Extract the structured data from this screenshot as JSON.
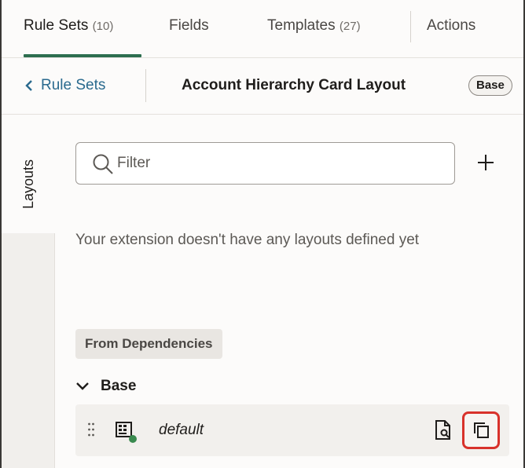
{
  "tabs": [
    {
      "label": "Rule Sets",
      "count": "(10)"
    },
    {
      "label": "Fields",
      "count": ""
    },
    {
      "label": "Templates",
      "count": "(27)"
    },
    {
      "label": "Actions",
      "count": ""
    }
  ],
  "breadcrumb": {
    "back_label": "Rule Sets",
    "title": "Account Hierarchy Card Layout",
    "badge": "Base"
  },
  "side_tab": {
    "label": "Layouts"
  },
  "filter": {
    "placeholder": "Filter"
  },
  "empty_message": "Your extension doesn't have any layouts defined yet",
  "dependencies": {
    "badge": "From Dependencies",
    "group_label": "Base",
    "items": [
      {
        "name": "default"
      }
    ]
  },
  "colors": {
    "accent": "#2d6e4f",
    "link": "#2a6a8e",
    "highlight": "#d8322b",
    "status_dot": "#3a8a4f"
  }
}
